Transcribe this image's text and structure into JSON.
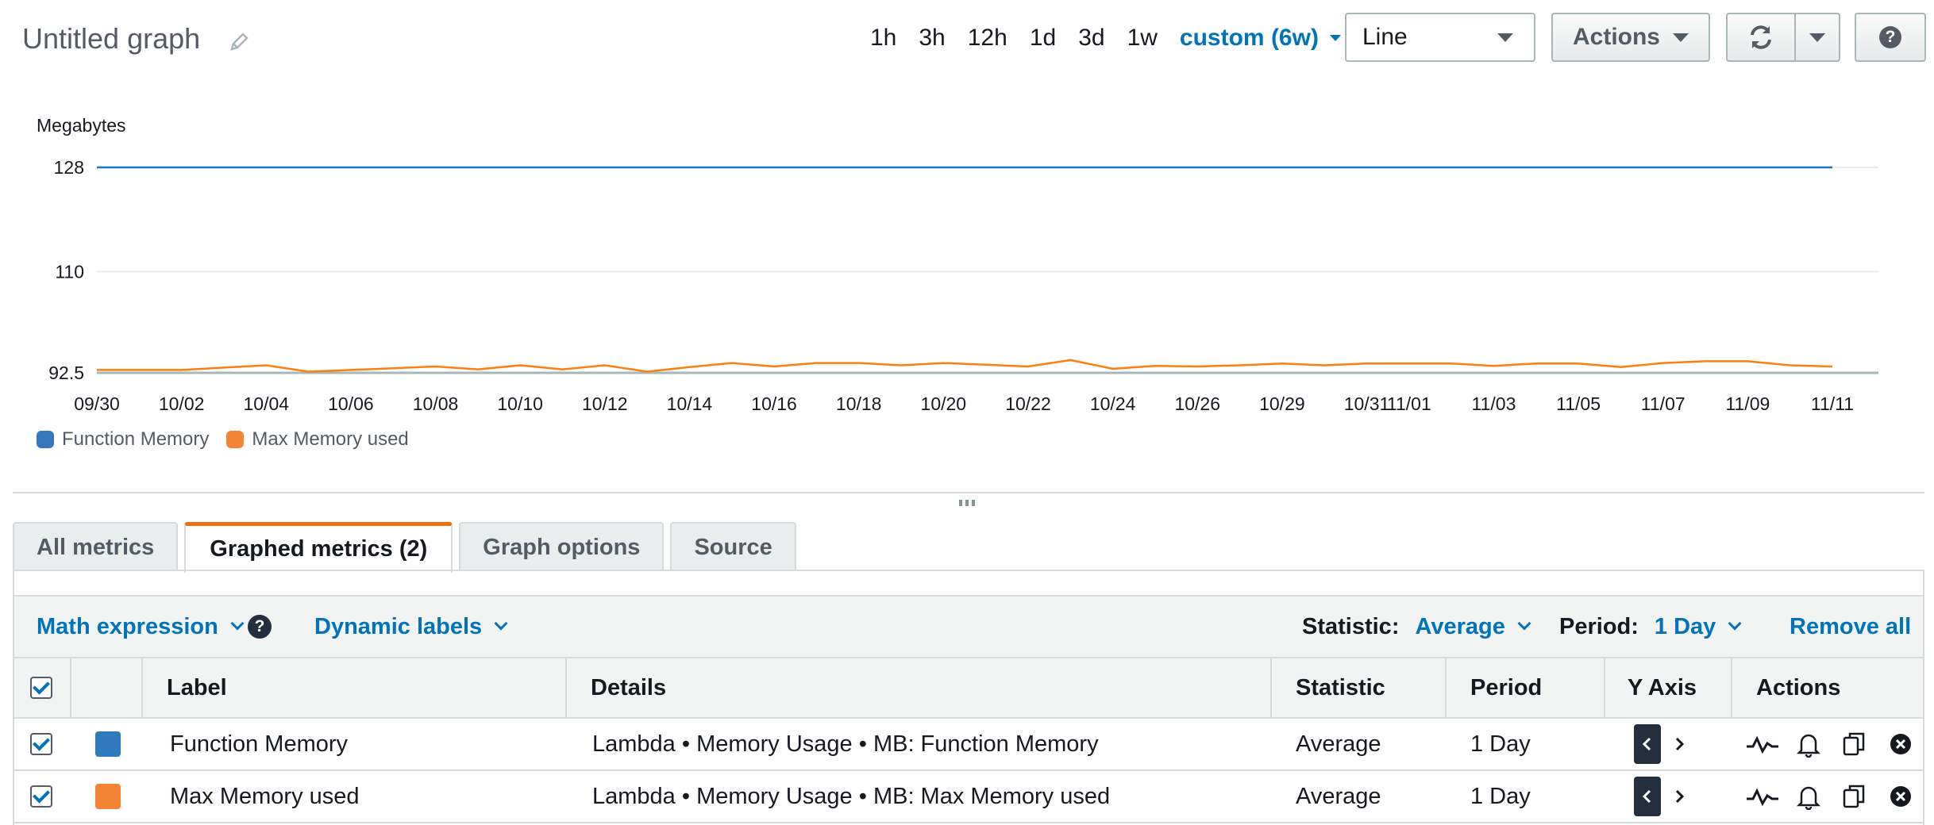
{
  "header": {
    "title": "Untitled graph",
    "time_ranges": [
      "1h",
      "3h",
      "12h",
      "1d",
      "3d",
      "1w"
    ],
    "custom_range": "custom (6w)",
    "graph_type": "Line",
    "actions_label": "Actions",
    "help_label": "?"
  },
  "chart_data": {
    "type": "line",
    "ylabel": "Megabytes",
    "yticks": [
      92.5,
      110,
      128
    ],
    "ylim": [
      92.5,
      128
    ],
    "x": [
      "09/30",
      "10/01",
      "10/02",
      "10/03",
      "10/04",
      "10/05",
      "10/06",
      "10/07",
      "10/08",
      "10/09",
      "10/10",
      "10/11",
      "10/12",
      "10/13",
      "10/14",
      "10/15",
      "10/16",
      "10/17",
      "10/18",
      "10/19",
      "10/20",
      "10/21",
      "10/22",
      "10/23",
      "10/24",
      "10/25",
      "10/26",
      "10/27",
      "10/29",
      "10/30",
      "10/31",
      "11/01",
      "11/02",
      "11/03",
      "11/04",
      "11/05",
      "11/06",
      "11/07",
      "11/08",
      "11/09",
      "11/10",
      "11/11"
    ],
    "xtick_labels": [
      "09/30",
      "10/02",
      "10/04",
      "10/06",
      "10/08",
      "10/10",
      "10/12",
      "10/14",
      "10/16",
      "10/18",
      "10/20",
      "10/22",
      "10/24",
      "10/26",
      "10/29",
      "10/31",
      "11/01",
      "11/03",
      "11/05",
      "11/07",
      "11/09",
      "11/11"
    ],
    "series": [
      {
        "name": "Function Memory",
        "color": "#1f77b4",
        "values": [
          128,
          128,
          128,
          128,
          128,
          128,
          128,
          128,
          128,
          128,
          128,
          128,
          128,
          128,
          128,
          128,
          128,
          128,
          128,
          128,
          128,
          128,
          128,
          128,
          128,
          128,
          128,
          128,
          128,
          128,
          128,
          128,
          128,
          128,
          128,
          128,
          128,
          128,
          128,
          128,
          128,
          128
        ]
      },
      {
        "name": "Max Memory used",
        "color": "#ff7f0e",
        "values": [
          93,
          93,
          93,
          93.4,
          93.8,
          92.7,
          93,
          93.3,
          93.6,
          93.1,
          93.8,
          93.1,
          93.8,
          92.7,
          93.5,
          94.2,
          93.6,
          94.2,
          94.2,
          93.8,
          94.2,
          93.9,
          93.6,
          94.7,
          93.2,
          93.7,
          93.6,
          93.8,
          94.1,
          93.8,
          94.1,
          94.1,
          94.1,
          93.7,
          94.1,
          94.1,
          93.5,
          94.2,
          94.5,
          94.5,
          93.8,
          93.6
        ]
      }
    ],
    "grid": true,
    "legend_position": "bottom-left"
  },
  "legend": [
    {
      "label": "Function Memory",
      "color": "#3578bd"
    },
    {
      "label": "Max Memory used",
      "color": "#f58536"
    }
  ],
  "tabs": [
    {
      "label": "All metrics",
      "active": false
    },
    {
      "label": "Graphed metrics (2)",
      "active": true
    },
    {
      "label": "Graph options",
      "active": false
    },
    {
      "label": "Source",
      "active": false
    }
  ],
  "toolbar": {
    "math_expression": "Math expression",
    "help": "?",
    "dynamic_labels": "Dynamic labels",
    "statistic_label": "Statistic:",
    "statistic_value": "Average",
    "period_label": "Period:",
    "period_value": "1 Day",
    "remove_all": "Remove all"
  },
  "table": {
    "headers": [
      "Label",
      "Details",
      "Statistic",
      "Period",
      "Y Axis",
      "Actions"
    ],
    "rows": [
      {
        "color": "#2f79bd",
        "label": "Function Memory",
        "details": "Lambda • Memory Usage • MB: Function Memory",
        "statistic": "Average",
        "period": "1 Day"
      },
      {
        "color": "#f58536",
        "label": "Max Memory used",
        "details": "Lambda • Memory Usage • MB: Max Memory used",
        "statistic": "Average",
        "period": "1 Day"
      }
    ]
  }
}
